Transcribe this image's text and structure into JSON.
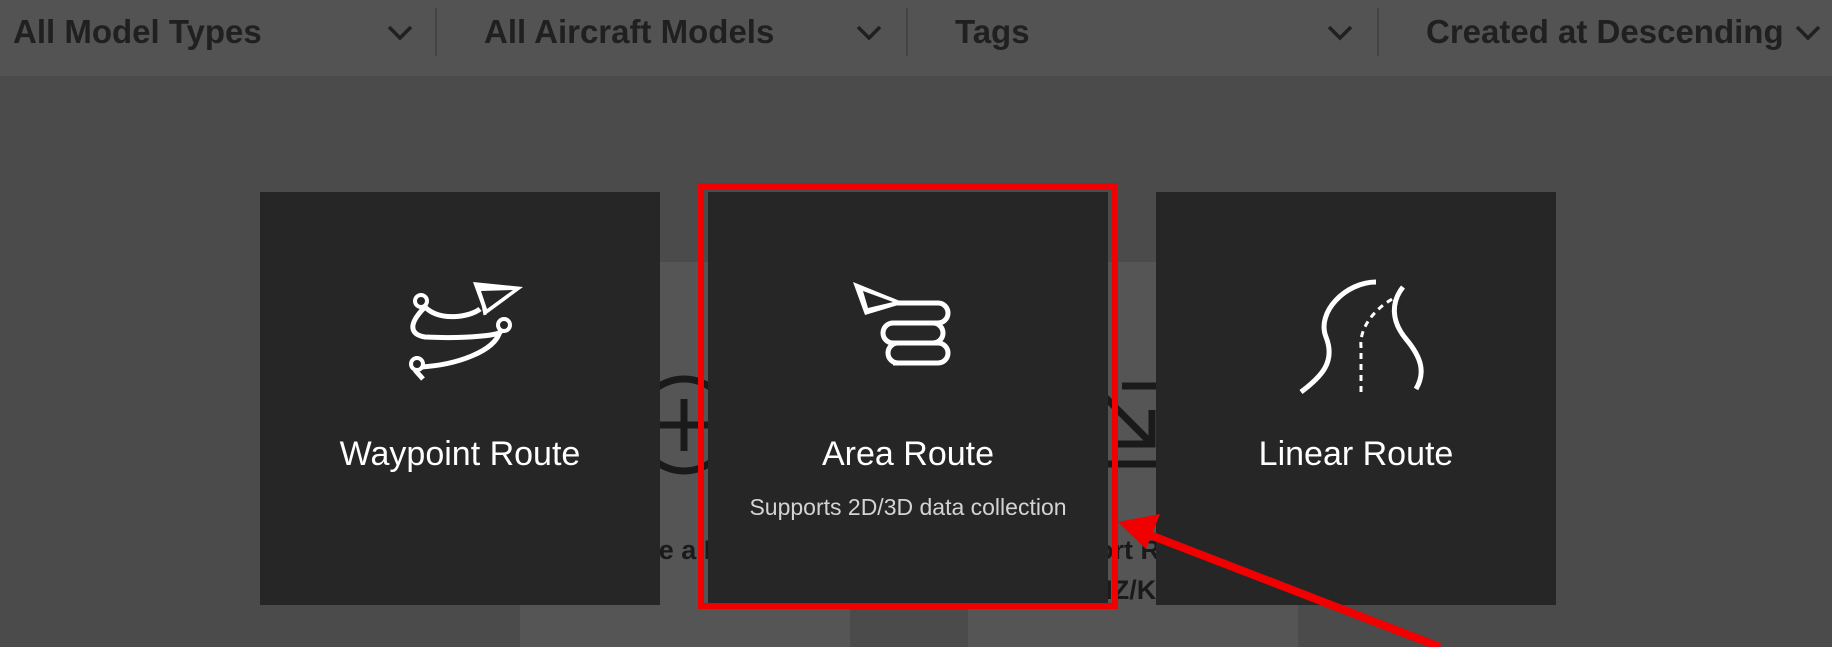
{
  "filters": [
    {
      "label": "All Model Types",
      "icon": "chevron-down-icon"
    },
    {
      "label": "All Aircraft Models",
      "icon": "chevron-down-icon"
    },
    {
      "label": "Tags",
      "icon": "chevron-down-icon"
    },
    {
      "label": "Created at Descending",
      "icon": "chevron-down-icon"
    }
  ],
  "background_actions": {
    "create": {
      "label": "Create a Route",
      "icon": "plus-circle-icon"
    },
    "import": {
      "label_line1": "Import Route",
      "label_line2": "(KMZ/KML)",
      "icon": "import-arrow-icon"
    }
  },
  "route_types": [
    {
      "title": "Waypoint Route",
      "subtitle": "",
      "icon": "waypoint-route-icon"
    },
    {
      "title": "Area Route",
      "subtitle": "Supports 2D/3D data collection",
      "icon": "area-route-icon"
    },
    {
      "title": "Linear Route",
      "subtitle": "",
      "icon": "linear-route-icon"
    }
  ],
  "annotation": {
    "highlight_color": "#f00000",
    "highlighted_item": "Area Route"
  },
  "colors": {
    "overlay": "#4b4b4b",
    "card": "#262626",
    "text": "#ffffff"
  }
}
